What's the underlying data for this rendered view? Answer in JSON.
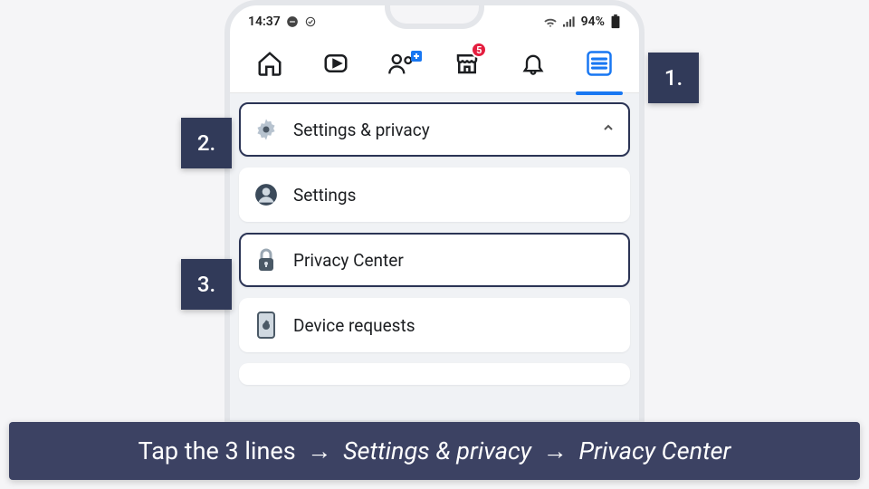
{
  "status": {
    "time": "14:37",
    "battery_pct": "94%"
  },
  "nav": {
    "badge_count": "5"
  },
  "menu": {
    "header": {
      "label": "Settings & privacy"
    },
    "items": [
      {
        "label": "Settings"
      },
      {
        "label": "Privacy Center"
      },
      {
        "label": "Device requests"
      }
    ]
  },
  "steps": {
    "s1": "1.",
    "s2": "2.",
    "s3": "3."
  },
  "caption": {
    "prefix": "Tap the 3 lines",
    "arrow": "→",
    "mid": "Settings & privacy",
    "last": "Privacy Center"
  }
}
